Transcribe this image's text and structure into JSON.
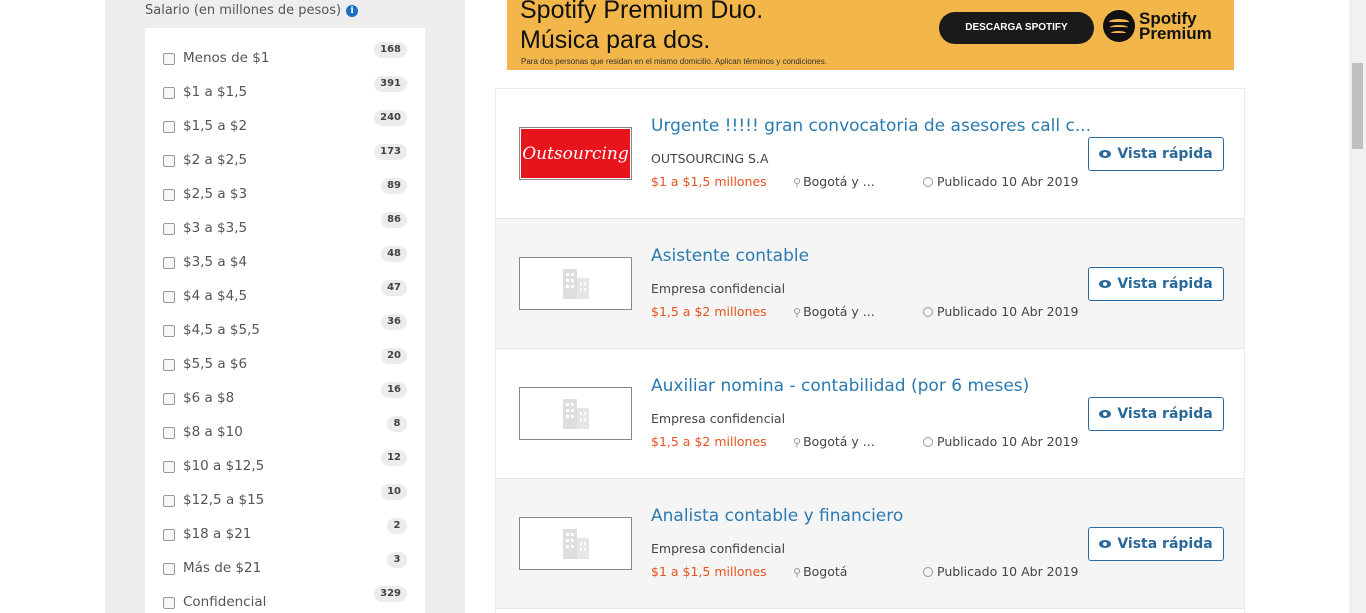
{
  "filter": {
    "title": "Salario (en millones de pesos)",
    "info_icon": "info-circle-icon",
    "items": [
      {
        "label": "Menos de $1",
        "count": "168"
      },
      {
        "label": "$1 a $1,5",
        "count": "391"
      },
      {
        "label": "$1,5 a $2",
        "count": "240"
      },
      {
        "label": "$2 a $2,5",
        "count": "173"
      },
      {
        "label": "$2,5 a $3",
        "count": "89"
      },
      {
        "label": "$3 a $3,5",
        "count": "86"
      },
      {
        "label": "$3,5 a $4",
        "count": "48"
      },
      {
        "label": "$4 a $4,5",
        "count": "47"
      },
      {
        "label": "$4,5 a $5,5",
        "count": "36"
      },
      {
        "label": "$5,5 a $6",
        "count": "20"
      },
      {
        "label": "$6 a $8",
        "count": "16"
      },
      {
        "label": "$8 a $10",
        "count": "8"
      },
      {
        "label": "$10 a $12,5",
        "count": "12"
      },
      {
        "label": "$12,5 a $15",
        "count": "10"
      },
      {
        "label": "$18 a $21",
        "count": "2"
      },
      {
        "label": "Más de $21",
        "count": "3"
      },
      {
        "label": "Confidencial",
        "count": "329"
      }
    ]
  },
  "banner": {
    "headline_1": "Spotify Premium Duo.",
    "headline_2": "Música para dos.",
    "fine_print": "Para dos personas que residan en el mismo domicilio. Aplican términos y condiciones.",
    "button": "DESCARGA SPOTIFY",
    "brand_1": "Spotify",
    "brand_2": "Premium",
    "brand_color": "#f2b64a"
  },
  "jobs": [
    {
      "title": "Urgente !!!!! gran convocatoria de asesores call c...",
      "company": "OUTSOURCING S.A",
      "company_logo_text": "Outsourcing",
      "salary": "$1 a $1,5 millones",
      "location": "Bogotá y ...",
      "date": "Publicado 10 Abr 2019",
      "button": "Vista rápida"
    },
    {
      "title": "Asistente contable",
      "company": "Empresa confidencial",
      "salary": "$1,5 a $2 millones",
      "location": "Bogotá y ...",
      "date": "Publicado 10 Abr 2019",
      "button": "Vista rápida"
    },
    {
      "title": "Auxiliar nomina - contabilidad (por 6 meses)",
      "company": "Empresa confidencial",
      "salary": "$1,5 a $2 millones",
      "location": "Bogotá y ...",
      "date": "Publicado 10 Abr 2019",
      "button": "Vista rápida"
    },
    {
      "title": "Analista contable y financiero",
      "company": "Empresa confidencial",
      "salary": "$1 a $1,5 millones",
      "location": "Bogotá",
      "date": "Publicado 10 Abr 2019",
      "button": "Vista rápida"
    }
  ],
  "colors": {
    "link": "#2a7ab0",
    "salary": "#e8521e",
    "button_border": "#2a6a9a"
  }
}
